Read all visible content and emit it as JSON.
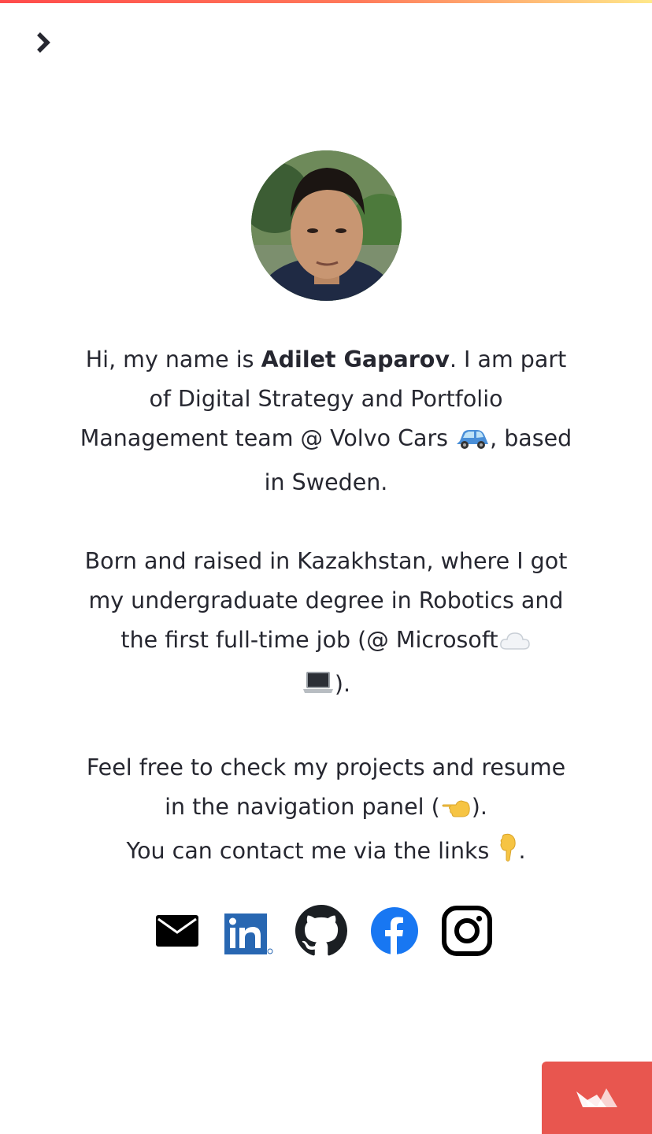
{
  "header": {
    "sidebar_toggle_icon": "chevron-right-icon"
  },
  "profile": {
    "avatar_icon": "profile-photo"
  },
  "intro": {
    "p1": {
      "prefix": "Hi, my name is ",
      "name": "Adilet Gaparov",
      "suffix_before_emoji": ". I am part of Digital Strategy and Portfolio Management team @ Volvo Cars ",
      "suffix_after_emoji": ", based in Sweden.",
      "emoji": "car-icon"
    },
    "p2": {
      "text_before_emoji": "Born and raised in Kazakhstan, where I got my undergraduate degree in Robotics and the first full-time job (@ Microsoft",
      "text_after_emoji": ").",
      "emojis": [
        "cloud-icon",
        "laptop-icon"
      ]
    },
    "p3": {
      "line1_before_emoji": "Feel free to check my projects and resume in the navigation panel (",
      "line1_after_emoji": ").",
      "line2_before_emoji": "You can contact me via the links ",
      "line2_after_emoji": ".",
      "emojis": [
        "hand-pointing-left-icon",
        "hand-pointing-down-icon"
      ]
    }
  },
  "socials": [
    {
      "name": "email",
      "icon": "mail-icon"
    },
    {
      "name": "linkedin",
      "icon": "linkedin-icon",
      "text": "in"
    },
    {
      "name": "github",
      "icon": "github-icon"
    },
    {
      "name": "facebook",
      "icon": "facebook-icon",
      "text": "f"
    },
    {
      "name": "instagram",
      "icon": "instagram-icon"
    }
  ],
  "footer": {
    "badge_icon": "streamlit-logo-icon"
  },
  "colors": {
    "text": "#262730",
    "linkedin": "#2867b2",
    "facebook": "#1877f2",
    "badge": "#e8564f"
  }
}
